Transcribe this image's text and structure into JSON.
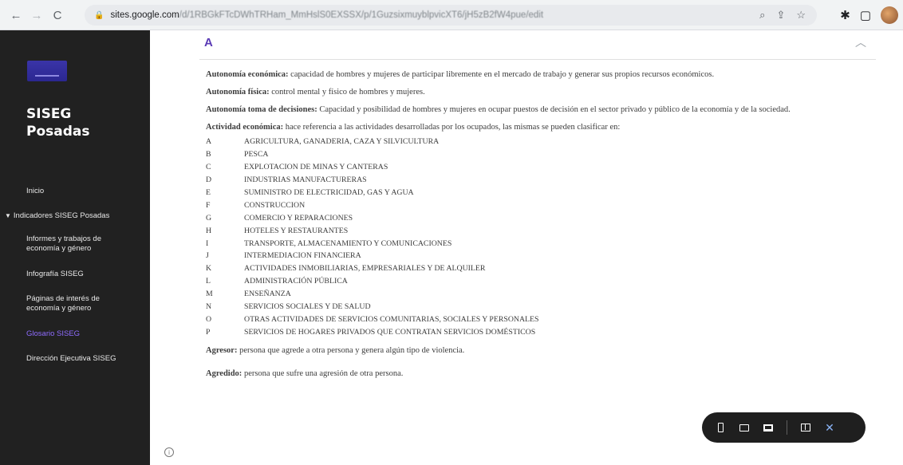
{
  "browser": {
    "url_domain": "sites.google.com",
    "url_path": "/d/1RBGkFTcDWhTRHam_MmHslS0EXSSX/p/1GuzsixmuyblpvicXT6/jH5zB2fW4pue/edit"
  },
  "sidebar": {
    "site_title": "SISEG Posadas",
    "items": [
      {
        "label": "Inicio"
      },
      {
        "label": "Indicadores SISEG Posadas"
      },
      {
        "label": "Informes y trabajos de economía y género"
      },
      {
        "label": "Infografía SISEG"
      },
      {
        "label": "Páginas de interés de economía y género"
      },
      {
        "label": "Glosario SISEG"
      },
      {
        "label": "Dirección Ejecutiva SISEG"
      }
    ]
  },
  "main": {
    "section_letter": "A",
    "paragraphs": [
      {
        "term": "Autonomía económica:",
        "text": " capacidad de hombres y mujeres de participar libremente en el mercado de trabajo y generar sus propios recursos económicos."
      },
      {
        "term": "Autonomía física:",
        "text": " control mental y físico de hombres y mujeres."
      },
      {
        "term": "Autonomía toma de decisiones:",
        "text": " Capacidad y posibilidad de hombres y mujeres en ocupar puestos de decisión en el sector privado y público de la economía y de la sociedad."
      },
      {
        "term": "Actividad económica:",
        "text": " hace referencia a las actividades desarrolladas por los ocupados, las mismas se pueden clasificar en:"
      }
    ],
    "activities": [
      {
        "code": "A",
        "name": "AGRICULTURA, GANADERIA, CAZA Y SILVICULTURA"
      },
      {
        "code": "B",
        "name": "PESCA"
      },
      {
        "code": "C",
        "name": "EXPLOTACION DE MINAS Y CANTERAS"
      },
      {
        "code": "D",
        "name": "INDUSTRIAS MANUFACTURERAS"
      },
      {
        "code": "E",
        "name": "SUMINISTRO DE ELECTRICIDAD, GAS Y AGUA"
      },
      {
        "code": "F",
        "name": "CONSTRUCCION"
      },
      {
        "code": "G",
        "name": "COMERCIO Y REPARACIONES"
      },
      {
        "code": "H",
        "name": "HOTELES Y RESTAURANTES"
      },
      {
        "code": "I",
        "name": "TRANSPORTE, ALMACENAMIENTO Y COMUNICACIONES"
      },
      {
        "code": "J",
        "name": "INTERMEDIACION FINANCIERA"
      },
      {
        "code": "K",
        "name": "ACTIVIDADES INMOBILIARIAS, EMPRESARIALES Y DE ALQUILER"
      },
      {
        "code": "L",
        "name": "ADMINISTRACIÓN PÚBLICA"
      },
      {
        "code": "M",
        "name": "ENSEÑANZA"
      },
      {
        "code": "N",
        "name": "SERVICIOS SOCIALES Y DE SALUD"
      },
      {
        "code": "O",
        "name": "OTRAS ACTIVIDADES DE SERVICIOS COMUNITARIAS, SOCIALES Y PERSONALES"
      },
      {
        "code": "P",
        "name": "SERVICIOS DE HOGARES PRIVADOS QUE CONTRATAN SERVICIOS DOMÉSTICOS"
      }
    ],
    "after": [
      {
        "term": "Agresor:",
        "text": " persona que agrede a otra persona y genera algún tipo de violencia."
      },
      {
        "term": "Agredido:",
        "text": " persona que sufre una agresión de otra persona."
      }
    ]
  },
  "colors": {
    "sidebar_bg": "#212121",
    "accent": "#5a3ab5",
    "active_nav": "#8f6cff"
  }
}
